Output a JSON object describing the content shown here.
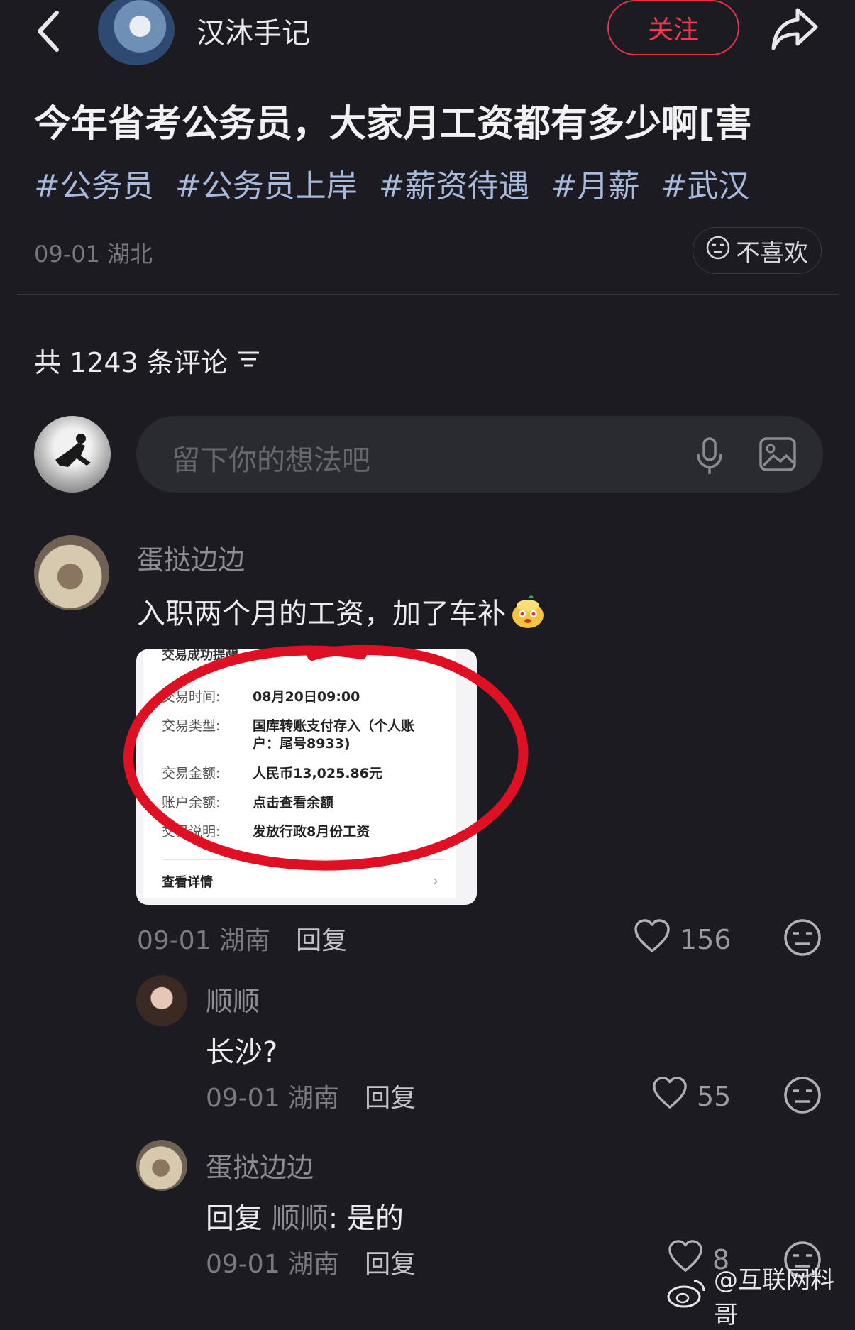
{
  "header": {
    "author_name": "汉沐手记",
    "follow_label": "关注",
    "back_icon": "chevron-left-icon",
    "share_icon": "share-arrow-icon"
  },
  "post": {
    "title": "今年省考公务员，大家月工资都有多少啊[害",
    "tags": [
      "#公务员",
      "#公务员上岸",
      "#薪资待遇",
      "#月薪",
      "#武汉"
    ],
    "meta": "09-01 湖北",
    "dislike_label": "不喜欢"
  },
  "comments_section": {
    "count_label": "共 1243 条评论",
    "input_placeholder": "留下你的想法吧"
  },
  "comments": [
    {
      "username": "蛋挞边边",
      "text": "入职两个月的工资，加了车补",
      "image": {
        "header": "交易成功提醒",
        "rows": [
          {
            "label": "交易时间:",
            "value": "08月20日09:00"
          },
          {
            "label": "交易类型:",
            "value": "国库转账支付存入（个人账"
          },
          {
            "label": "",
            "value": "户：尾号8933)"
          },
          {
            "label": "交易金额:",
            "value": "人民币13,025.86元"
          },
          {
            "label": "账户余额:",
            "value": "点击查看余额"
          },
          {
            "label": "交易说明:",
            "value": "发放行政8月份工资"
          }
        ],
        "detail_label": "查看详情"
      },
      "meta": "09-01 湖南",
      "reply_label": "回复",
      "likes": "156"
    },
    {
      "username": "顺顺",
      "text": "长沙?",
      "meta": "09-01 湖南",
      "reply_label": "回复",
      "likes": "55"
    },
    {
      "username": "蛋挞边边",
      "reply_prefix": "回复",
      "reply_to": "顺顺",
      "text": ": 是的",
      "meta": "09-01 湖南",
      "reply_label": "回复",
      "likes": "8"
    }
  ],
  "watermark": "@互联网料哥",
  "colors": {
    "background": "#1c1b22",
    "accent_red": "#e53249",
    "tag_blue": "#a8b9db"
  }
}
